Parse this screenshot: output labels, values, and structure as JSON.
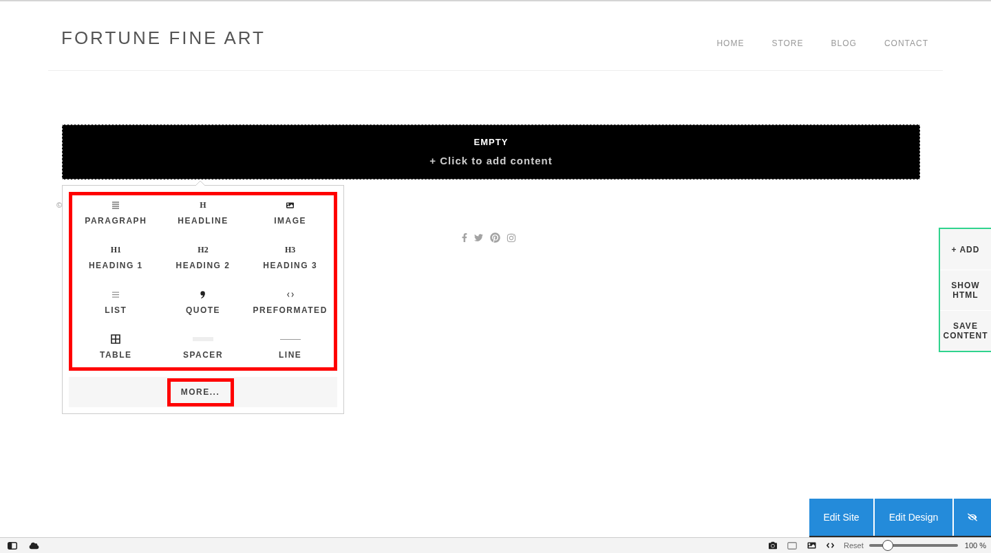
{
  "site_header": {
    "logo": "FORTUNE FINE ART",
    "nav": [
      "HOME",
      "STORE",
      "BLOG",
      "CONTACT"
    ]
  },
  "empty_block": {
    "title": "EMPTY",
    "action": "+ Click to add content"
  },
  "footer": {
    "copyright": "©"
  },
  "add_menu": {
    "highlighted": true,
    "rows": [
      [
        {
          "label": "PARAGRAPH",
          "kind": "paragraph"
        },
        {
          "label": "HEADLINE",
          "kind": "glyph",
          "glyph": "H"
        },
        {
          "label": "IMAGE",
          "kind": "image"
        }
      ],
      [
        {
          "label": "HEADING 1",
          "kind": "glyph",
          "glyph": "H1"
        },
        {
          "label": "HEADING 2",
          "kind": "glyph",
          "glyph": "H2"
        },
        {
          "label": "HEADING 3",
          "kind": "glyph",
          "glyph": "H3"
        }
      ],
      [
        {
          "label": "LIST",
          "kind": "list"
        },
        {
          "label": "QUOTE",
          "kind": "quote"
        },
        {
          "label": "PREFORMATED",
          "kind": "code"
        }
      ],
      [
        {
          "label": "TABLE",
          "kind": "table"
        },
        {
          "label": "SPACER",
          "kind": "spacer"
        },
        {
          "label": "LINE",
          "kind": "line"
        }
      ]
    ],
    "more_button": {
      "label": "MORE...",
      "highlighted": true
    }
  },
  "side_panel": {
    "buttons": [
      "+ ADD",
      "SHOW HTML",
      "SAVE CONTENT"
    ]
  },
  "edit_bar": {
    "buttons": [
      "Edit Site",
      "Edit Design"
    ]
  },
  "status_bar": {
    "reset_label": "Reset",
    "zoom": {
      "level": 0.21,
      "reading": "100 %"
    }
  }
}
